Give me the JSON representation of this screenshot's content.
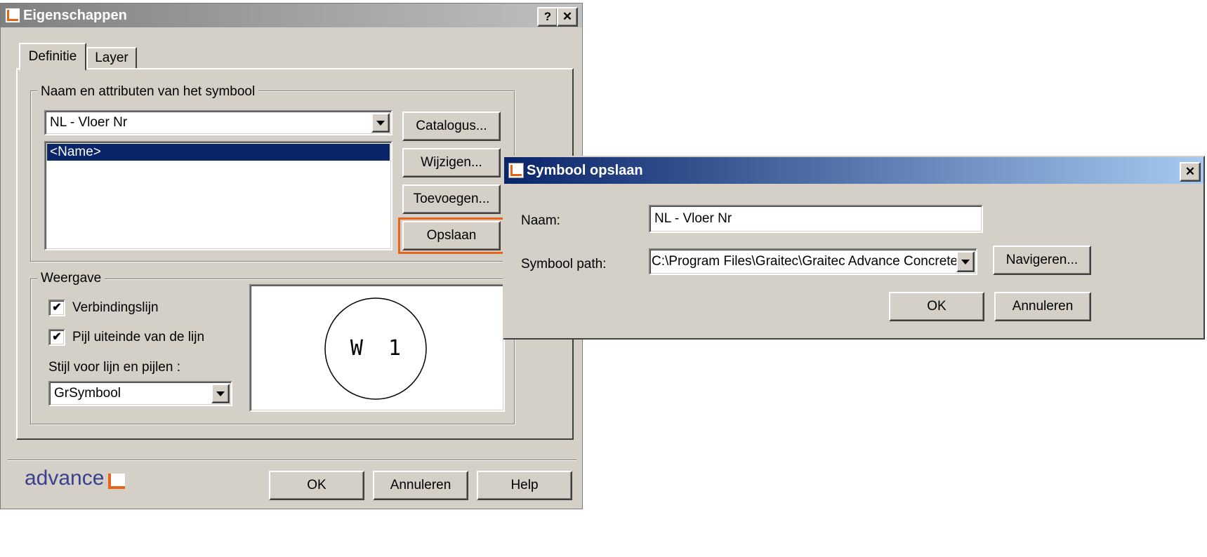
{
  "main_dialog": {
    "title": "Eigenschappen",
    "help_glyph": "?",
    "close_glyph": "✕",
    "tabs": [
      {
        "label": "Definitie",
        "active": true
      },
      {
        "label": "Layer",
        "active": false
      }
    ],
    "group_name": {
      "label": "Naam en attributen van het symbool",
      "symbol_combo_value": "NL - Vloer Nr",
      "attributes_list": [
        "<Name>"
      ],
      "buttons": {
        "catalogus": "Catalogus...",
        "wijzigen": "Wijzigen...",
        "toevoegen": "Toevoegen...",
        "opslaan": "Opslaan"
      }
    },
    "group_display": {
      "label": "Weergave",
      "checkbox_connection": {
        "label": "Verbindingslijn",
        "checked": true
      },
      "checkbox_arrow": {
        "label": "Pijl uiteinde van de lijn",
        "checked": true
      },
      "style_label": "Stijl voor lijn en pijlen :",
      "style_combo_value": "GrSymbool",
      "preview_text": "W  1"
    },
    "logo_text": "advance",
    "footer_buttons": {
      "ok": "OK",
      "cancel": "Annuleren",
      "help": "Help"
    }
  },
  "save_dialog": {
    "title": "Symbool opslaan",
    "close_glyph": "✕",
    "name_label": "Naam:",
    "name_value": "NL - Vloer Nr",
    "path_label": "Symbool path:",
    "path_value": "C:\\Program Files\\Graitec\\Graitec Advance Concrete",
    "browse_button": "Navigeren...",
    "ok_button": "OK",
    "cancel_button": "Annuleren"
  },
  "colors": {
    "highlight": "#0a246a",
    "callout": "#e8641b",
    "logo_text": "#3a3f8f"
  }
}
